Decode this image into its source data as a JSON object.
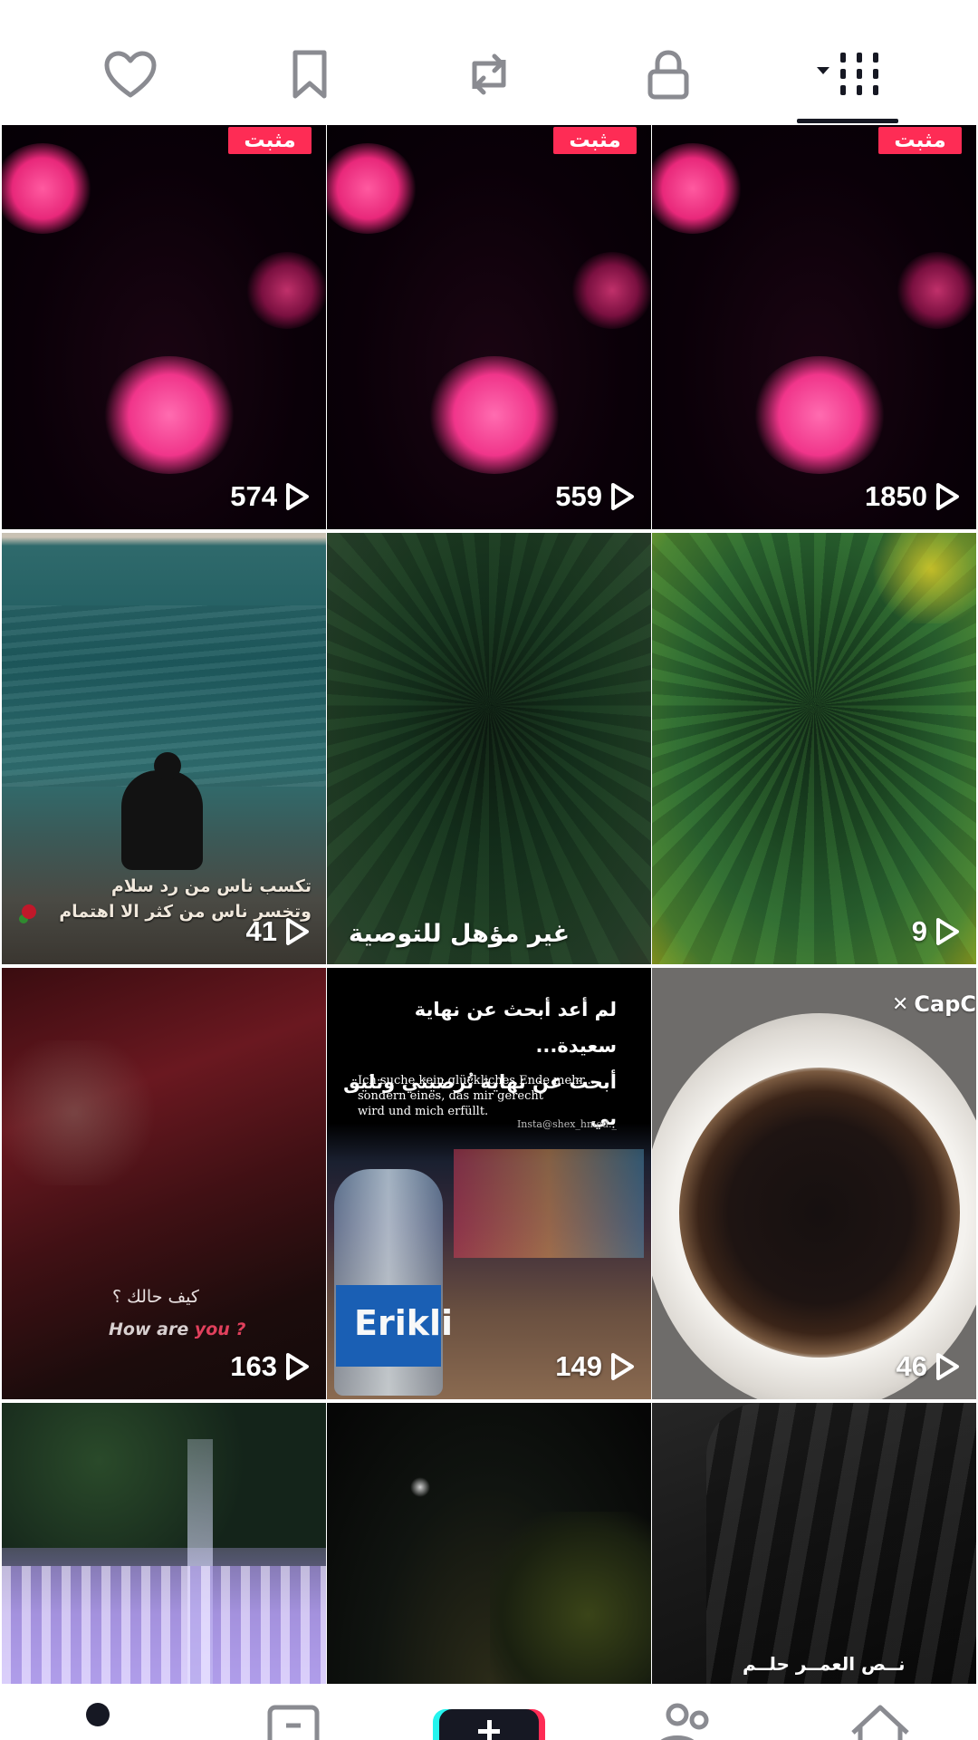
{
  "profile_tabs": [
    {
      "icon": "liked-heart-icon"
    },
    {
      "icon": "bookmark-icon"
    },
    {
      "icon": "repost-icon"
    },
    {
      "icon": "lock-icon"
    },
    {
      "icon": "grid-menu-icon",
      "selected": true
    }
  ],
  "pinned_label": "مثبت",
  "videos": [
    {
      "views": "574",
      "pinned": true
    },
    {
      "views": "559",
      "pinned": true
    },
    {
      "views": "1850",
      "pinned": true
    },
    {
      "views": "41",
      "caption_lines": [
        "تكسب ناس من رد سلام",
        "وتخسر ناس من كثر الا اهتمام"
      ]
    },
    {
      "status": "غير مؤهل للتوصية"
    },
    {
      "views": "9"
    },
    {
      "views": "163",
      "caption_ar": "كيف حالك ؟",
      "caption_en_1": "How are ",
      "caption_en_2": "you ?"
    },
    {
      "views": "149",
      "caption_lines": [
        "لم أعد أبحث عن نهاية سعيدة...",
        "أبحث عن نهاية تُرضيني وتليق بي"
      ],
      "caption_de": [
        "Ich suche kein glückliches Ende mehr...",
        "sondern eines, das mir gerecht",
        "wird und mich erfüllt."
      ],
      "handle": "Insta@shex_hmed._",
      "bottle_brand": "Erikli"
    },
    {
      "views": "46",
      "watermark": "CapC"
    },
    {},
    {},
    {
      "caption": "نــص العمــر حلــم"
    }
  ],
  "bottom_nav": [
    {
      "icon": "home-icon"
    },
    {
      "icon": "friends-icon"
    },
    {
      "icon": "create-plus-icon"
    },
    {
      "icon": "inbox-icon"
    },
    {
      "icon": "profile-icon",
      "active": true
    }
  ],
  "colors": {
    "accent": "#fe2c55",
    "text_dark": "#161823",
    "icon_gray": "#8a8b91"
  }
}
